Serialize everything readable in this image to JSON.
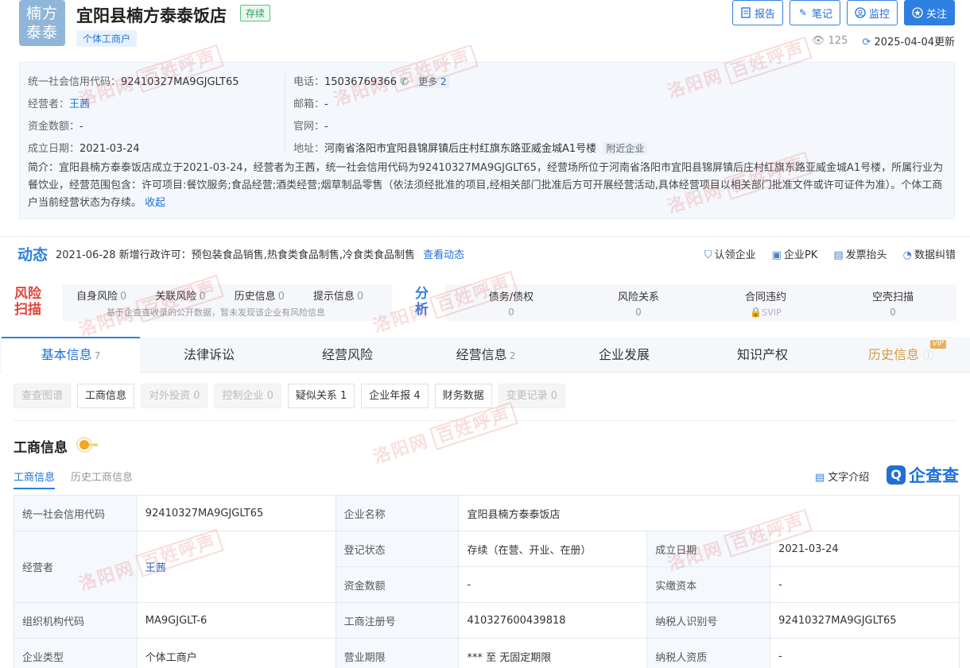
{
  "header": {
    "logo_line1": "楠方",
    "logo_line2": "泰泰",
    "company_name": "宜阳县楠方泰泰饭店",
    "status": "存续",
    "type": "个体工商户",
    "buttons": {
      "report": "报告",
      "note": "笔记",
      "monitor": "监控",
      "follow": "关注"
    },
    "views": "125",
    "updated": "2025-04-04更新"
  },
  "info": {
    "credit_code_label": "统一社会信用代码：",
    "credit_code": "92410327MA9GJGLT65",
    "operator_label": "经营者：",
    "operator": "王茜",
    "capital_label": "资金数额：",
    "capital": "-",
    "founded_label": "成立日期：",
    "founded": "2021-03-24",
    "phone_label": "电话：",
    "phone": "15036769366",
    "more": "更多",
    "more_count": "2",
    "email_label": "邮箱：",
    "email": "-",
    "website_label": "官网：",
    "website": "-",
    "address_label": "地址：",
    "address": "河南省洛阳市宜阳县锦屏镇后庄村红旗东路亚威金城A1号楼",
    "nearby": "附近企业",
    "intro": "简介：宜阳县楠方泰泰饭店成立于2021-03-24，经营者为王茜，统一社会信用代码为92410327MA9GJGLT65，经营场所位于河南省洛阳市宜阳县锦屏镇后庄村红旗东路亚威金城A1号楼，所属行业为餐饮业，经营范围包含：许可项目:餐饮服务;食品经营;酒类经营;烟草制品零售（依法须经批准的项目,经相关部门批准后方可开展经营活动,具体经营项目以相关部门批准文件或许可证件为准）。个体工商户当前经营状态为存续。",
    "collapse": "收起"
  },
  "dynamic": {
    "title": "动态",
    "text": "2021-06-28 新增行政许可：预包装食品销售,热食类食品制售,冷食类食品制售",
    "link": "查看动态",
    "actions": [
      "认领企业",
      "企业PK",
      "发票抬头",
      "数据纠错"
    ]
  },
  "risk": {
    "title_line1": "风险",
    "title_line2": "扫描",
    "items": [
      {
        "label": "自身风险",
        "count": "0"
      },
      {
        "label": "关联风险",
        "count": "0"
      },
      {
        "label": "历史信息",
        "count": "0"
      },
      {
        "label": "提示信息",
        "count": "0"
      }
    ],
    "note": "基于企查查收录的公开数据，暂未发现该企业有风险信息",
    "analysis_line1": "分",
    "analysis_line2": "析",
    "analysis": [
      {
        "label": "债务/债权",
        "value": "0"
      },
      {
        "label": "风险关系",
        "value": "0"
      },
      {
        "label": "合同违约",
        "value": "SVIP"
      },
      {
        "label": "空壳扫描",
        "value": "0"
      }
    ]
  },
  "tabs": [
    {
      "label": "基本信息",
      "count": "7"
    },
    {
      "label": "法律诉讼",
      "count": ""
    },
    {
      "label": "经营风险",
      "count": ""
    },
    {
      "label": "经营信息",
      "count": "2"
    },
    {
      "label": "企业发展",
      "count": ""
    },
    {
      "label": "知识产权",
      "count": ""
    },
    {
      "label": "历史信息",
      "count": "",
      "badge": "VIP"
    }
  ],
  "sub_tabs": [
    {
      "label": "查查图谱",
      "disabled": true
    },
    {
      "label": "工商信息",
      "disabled": false
    },
    {
      "label": "对外投资 0",
      "disabled": true
    },
    {
      "label": "控制企业 0",
      "disabled": true
    },
    {
      "label": "疑似关系 1",
      "disabled": false
    },
    {
      "label": "企业年报 4",
      "disabled": false
    },
    {
      "label": "财务数据",
      "disabled": false
    },
    {
      "label": "变更记录 0",
      "disabled": true
    }
  ],
  "section": {
    "title": "工商信息",
    "tab_active": "工商信息",
    "tab_other": "历史工商信息",
    "text_intro": "文字介绍",
    "brand": "企查查"
  },
  "table": {
    "r1": [
      "统一社会信用代码",
      "92410327MA9GJGLT65",
      "企业名称",
      "宜阳县楠方泰泰饭店"
    ],
    "r2": [
      "经营者",
      "王茜",
      "登记状态",
      "存续（在营、开业、在册）",
      "成立日期",
      "2021-03-24"
    ],
    "r3": [
      "资金数额",
      "-",
      "实缴资本",
      "-"
    ],
    "r4": [
      "组织机构代码",
      "MA9GJGLT-6",
      "工商注册号",
      "410327600439818",
      "纳税人识别号",
      "92410327MA9GJGLT65"
    ],
    "r5": [
      "企业类型",
      "个体工商户",
      "营业期限",
      "*** 至 无固定期限",
      "纳税人资质",
      "-"
    ]
  },
  "watermark": {
    "site": "洛阳网",
    "brand": "百姓呼声"
  }
}
